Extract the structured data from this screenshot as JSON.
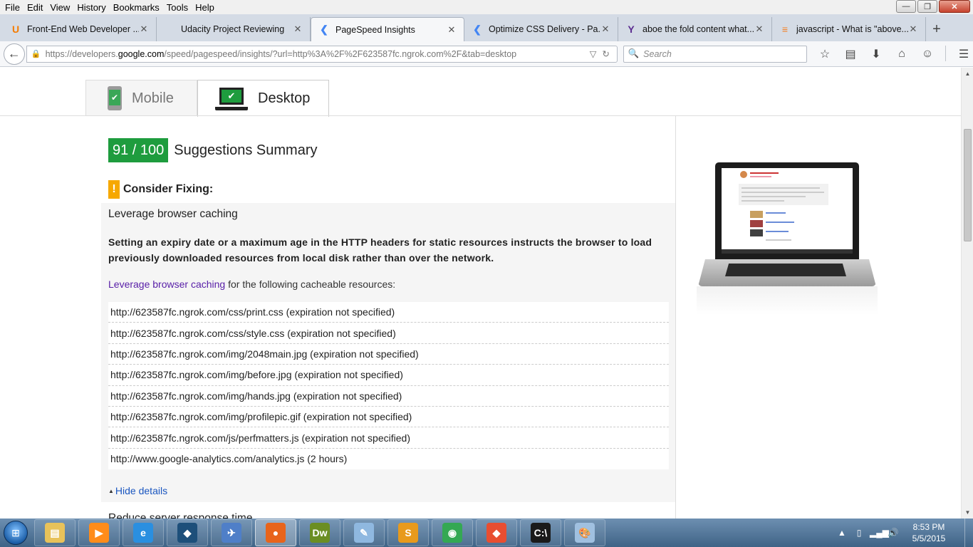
{
  "menu": [
    "File",
    "Edit",
    "View",
    "History",
    "Bookmarks",
    "Tools",
    "Help"
  ],
  "window_controls": {
    "minimize": "—",
    "maximize": "❐",
    "close": "✕"
  },
  "tabs": [
    {
      "title": "Front-End Web Developer ...",
      "icon": "udacity-icon",
      "color": "#f57c00",
      "glyph": "U"
    },
    {
      "title": "Udacity Project Reviewing",
      "icon": "blank-page-icon",
      "color": "#888888",
      "glyph": ""
    },
    {
      "title": "PageSpeed Insights",
      "icon": "pagespeed-icon",
      "color": "#4285f4",
      "glyph": "❮"
    },
    {
      "title": "Optimize CSS Delivery - Pa...",
      "icon": "pagespeed-icon",
      "color": "#4285f4",
      "glyph": "❮"
    },
    {
      "title": "aboe the fold content what...",
      "icon": "yahoo-icon",
      "color": "#5c2d91",
      "glyph": "Y"
    },
    {
      "title": "javascript - What is \"above...",
      "icon": "stackoverflow-icon",
      "color": "#f48024",
      "glyph": "≡"
    }
  ],
  "active_tab": 2,
  "newtab_label": "+",
  "url": {
    "prefix": "https://developers.",
    "domain": "google.com",
    "suffix": "/speed/pagespeed/insights/?url=http%3A%2F%2F623587fc.ngrok.com%2F&tab=desktop"
  },
  "search_placeholder": "Search",
  "page": {
    "device_tabs": {
      "mobile": "Mobile",
      "desktop": "Desktop"
    },
    "score": "91 / 100",
    "summary_title": "Suggestions Summary",
    "consider_fixing": "Consider Fixing:",
    "rule_name": "Leverage browser caching",
    "rule_description": "Setting an expiry date or a maximum age in the HTTP headers for static resources instructs the browser to load previously downloaded resources from local disk rather than over the network.",
    "rule_link": "Leverage browser caching",
    "rule_lead_rest": " for the following cacheable resources:",
    "resources": [
      "http://623587fc.ngrok.com/css/print.css (expiration not specified)",
      "http://623587fc.ngrok.com/css/style.css (expiration not specified)",
      "http://623587fc.ngrok.com/img/2048main.jpg (expiration not specified)",
      "http://623587fc.ngrok.com/img/before.jpg (expiration not specified)",
      "http://623587fc.ngrok.com/img/hands.jpg (expiration not specified)",
      "http://623587fc.ngrok.com/img/profilepic.gif (expiration not specified)",
      "http://623587fc.ngrok.com/js/perfmatters.js (expiration not specified)",
      "http://www.google-analytics.com/analytics.js (2 hours)"
    ],
    "hide_details": "Hide details",
    "next_rule": "Reduce server response time"
  },
  "taskbar": {
    "apps": [
      {
        "name": "file-explorer-icon",
        "color": "#e8c25a",
        "glyph": "▤"
      },
      {
        "name": "media-player-icon",
        "color": "#ff8c1a",
        "glyph": "▶"
      },
      {
        "name": "internet-explorer-icon",
        "color": "#2a8fe0",
        "glyph": "e"
      },
      {
        "name": "mysql-workbench-icon",
        "color": "#1d4f7a",
        "glyph": "◆"
      },
      {
        "name": "ftp-client-icon",
        "color": "#4f7fc8",
        "glyph": "✈"
      },
      {
        "name": "firefox-icon",
        "color": "#e8641b",
        "glyph": "●"
      },
      {
        "name": "dreamweaver-icon",
        "color": "#6b8e23",
        "glyph": "Dw"
      },
      {
        "name": "notepad-icon",
        "color": "#8fb8e0",
        "glyph": "✎"
      },
      {
        "name": "sublime-text-icon",
        "color": "#e89a1c",
        "glyph": "S"
      },
      {
        "name": "chrome-icon",
        "color": "#34a853",
        "glyph": "◉"
      },
      {
        "name": "git-icon",
        "color": "#e84e31",
        "glyph": "◆"
      },
      {
        "name": "command-prompt-icon",
        "color": "#1a1a1a",
        "glyph": "C:\\"
      },
      {
        "name": "paint-icon",
        "color": "#a0c0e0",
        "glyph": "🎨"
      }
    ],
    "active_app": 5,
    "time": "8:53 PM",
    "date": "5/5/2015"
  }
}
